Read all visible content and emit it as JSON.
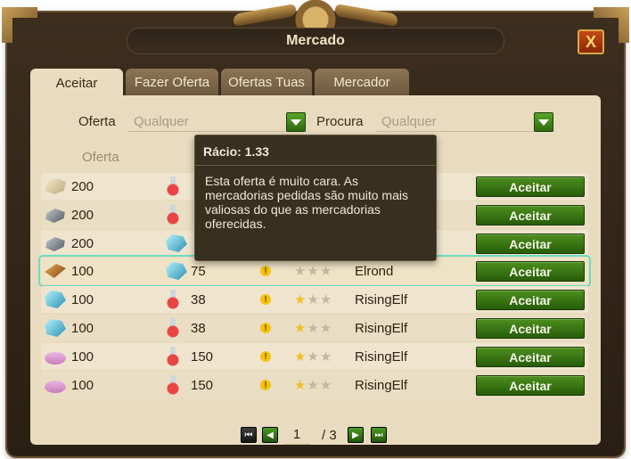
{
  "window": {
    "title": "Mercado",
    "close_label": "X"
  },
  "tabs": [
    {
      "label": "Aceitar",
      "active": true
    },
    {
      "label": "Fazer Oferta",
      "active": false
    },
    {
      "label": "Ofertas Tuas",
      "active": false
    },
    {
      "label": "Mercador",
      "active": false
    }
  ],
  "filters": {
    "offer_label": "Oferta",
    "offer_value": "Qualquer",
    "demand_label": "Procura",
    "demand_value": "Qualquer"
  },
  "columns": {
    "offer": "Oferta"
  },
  "rows": [
    {
      "offer_icon": "marble-icon",
      "offer_qty": "200",
      "want_icon": "potion-icon",
      "want_qty": "",
      "warning": false,
      "stars": 0,
      "player": "",
      "action": "Aceitar",
      "highlight": false
    },
    {
      "offer_icon": "steel-icon",
      "offer_qty": "200",
      "want_icon": "potion-icon",
      "want_qty": "",
      "warning": false,
      "stars": 0,
      "player": "",
      "action": "Aceitar",
      "highlight": false
    },
    {
      "offer_icon": "steel-icon",
      "offer_qty": "200",
      "want_icon": "gem-icon",
      "want_qty": "",
      "warning": false,
      "stars": 0,
      "player": "",
      "action": "Aceitar",
      "highlight": false
    },
    {
      "offer_icon": "plank-icon",
      "offer_qty": "100",
      "want_icon": "gem-icon",
      "want_qty": "75",
      "warning": true,
      "stars": 0,
      "player": "Elrond",
      "action": "Aceitar",
      "highlight": true
    },
    {
      "offer_icon": "gem-icon",
      "offer_qty": "100",
      "want_icon": "potion-icon",
      "want_qty": "38",
      "warning": true,
      "stars": 1,
      "player": "RisingElf",
      "action": "Aceitar",
      "highlight": false
    },
    {
      "offer_icon": "gem-icon",
      "offer_qty": "100",
      "want_icon": "potion-icon",
      "want_qty": "38",
      "warning": true,
      "stars": 1,
      "player": "RisingElf",
      "action": "Aceitar",
      "highlight": false
    },
    {
      "offer_icon": "silk-icon",
      "offer_qty": "100",
      "want_icon": "potion-icon",
      "want_qty": "150",
      "warning": true,
      "stars": 1,
      "player": "RisingElf",
      "action": "Aceitar",
      "highlight": false
    },
    {
      "offer_icon": "silk-icon",
      "offer_qty": "100",
      "want_icon": "potion-icon",
      "want_qty": "150",
      "warning": true,
      "stars": 1,
      "player": "RisingElf",
      "action": "Aceitar",
      "highlight": false
    }
  ],
  "pagination": {
    "current": "1",
    "total": "/ 3"
  },
  "tooltip": {
    "title": "Rácio: 1.33",
    "body": "Esta oferta é muito cara. As mercadorias pedidas são muito mais valiosas do que as mercadorias oferecidas."
  }
}
